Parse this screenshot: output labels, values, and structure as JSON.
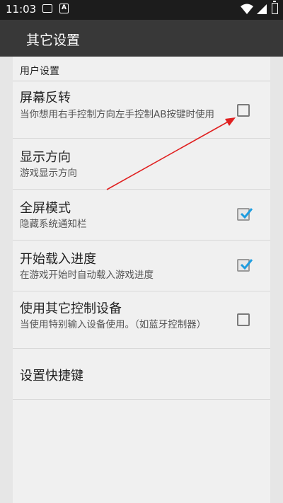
{
  "status_bar": {
    "time": "11:03",
    "icons": [
      "image-icon",
      "text-a-icon",
      "wifi-icon",
      "cell-signal-icon",
      "battery-charging-icon"
    ]
  },
  "app_bar": {
    "title": "其它设置"
  },
  "category": {
    "title": "用户设置"
  },
  "preferences": [
    {
      "title": "屏幕反转",
      "summary": "当你想用右手控制方向左手控制AB按键时使用",
      "has_checkbox": true,
      "checked": false
    },
    {
      "title": "显示方向",
      "summary": "游戏显示方向",
      "has_checkbox": false
    },
    {
      "title": "全屏模式",
      "summary": "隐藏系统通知栏",
      "has_checkbox": true,
      "checked": true
    },
    {
      "title": "开始载入进度",
      "summary": "在游戏开始时自动载入游戏进度",
      "has_checkbox": true,
      "checked": true
    },
    {
      "title": "使用其它控制设备",
      "summary": "当使用特别输入设备使用。（如蓝牙控制器）",
      "has_checkbox": true,
      "checked": false
    },
    {
      "title": "设置快捷键",
      "summary": "",
      "has_checkbox": false
    }
  ],
  "colors": {
    "accent": "#1e9de0",
    "annotation_arrow": "#e02020"
  }
}
